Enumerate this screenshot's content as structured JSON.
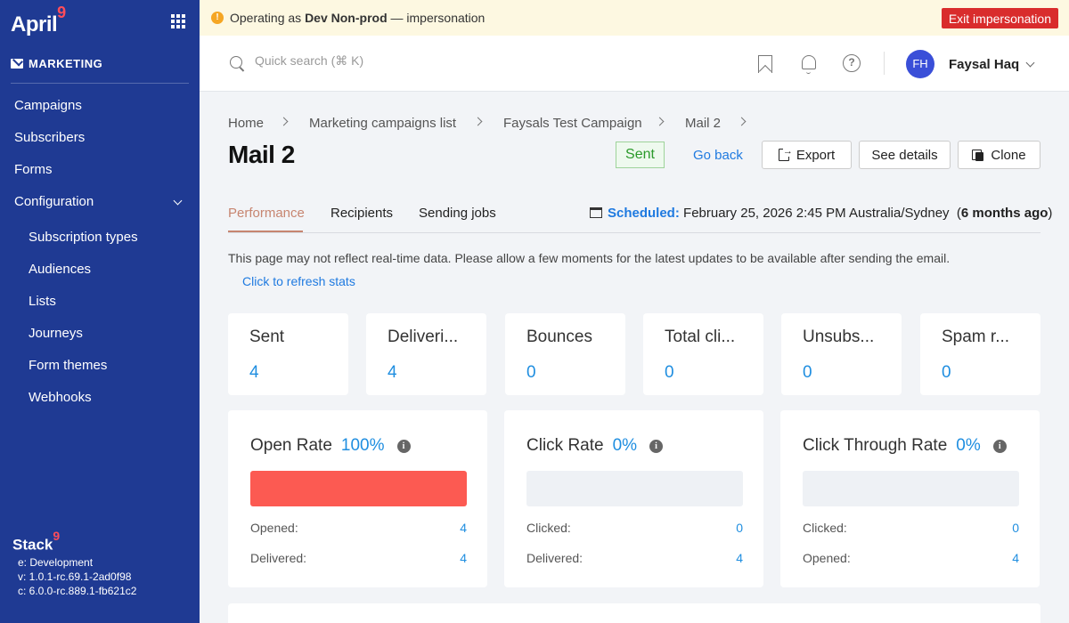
{
  "sidebar": {
    "logo": "April",
    "logo_sup": "9",
    "section": "MARKETING",
    "items": [
      {
        "label": "Campaigns"
      },
      {
        "label": "Subscribers"
      },
      {
        "label": "Forms"
      },
      {
        "label": "Configuration"
      }
    ],
    "sub_items": [
      {
        "label": "Subscription types"
      },
      {
        "label": "Audiences"
      },
      {
        "label": "Lists"
      },
      {
        "label": "Journeys"
      },
      {
        "label": "Form themes"
      },
      {
        "label": "Webhooks"
      }
    ],
    "stack_logo": "Stack",
    "stack_sup": "9",
    "build": {
      "env": "e: Development",
      "version": "v: 1.0.1-rc.69.1-2ad0f98",
      "core": "c: 6.0.0-rc.889.1-fb621c2"
    }
  },
  "banner": {
    "prefix": "Operating as",
    "org": "Dev Non-prod",
    "suffix": "— impersonation",
    "exit_label": "Exit impersonation",
    "warn_glyph": "!"
  },
  "header": {
    "search_placeholder": "Quick search (⌘ K)",
    "help_glyph": "?",
    "user": {
      "initials": "FH",
      "name": "Faysal Haq"
    }
  },
  "breadcrumb": [
    "Home",
    "Marketing campaigns list",
    "Faysals Test Campaign",
    "Mail 2"
  ],
  "page": {
    "title": "Mail 2",
    "status": "Sent",
    "go_back": "Go back",
    "actions": {
      "export": "Export",
      "details": "See details",
      "clone": "Clone"
    }
  },
  "tabs": [
    "Performance",
    "Recipients",
    "Sending jobs"
  ],
  "scheduled": {
    "label": "Scheduled:",
    "value": "February 25, 2026 2:45 PM Australia/Sydney",
    "relative": "6 months ago"
  },
  "notice": "This page may not reflect real-time data. Please allow a few moments for the latest updates to be available after sending the email.",
  "refresh_label": "Click to refresh stats",
  "stats": [
    {
      "title": "Sent",
      "value": "4"
    },
    {
      "title": "Deliveri...",
      "value": "4"
    },
    {
      "title": "Bounces",
      "value": "0"
    },
    {
      "title": "Total cli...",
      "value": "0"
    },
    {
      "title": "Unsubs...",
      "value": "0"
    },
    {
      "title": "Spam r...",
      "value": "0"
    }
  ],
  "rates": [
    {
      "title": "Open Rate",
      "pct": "100%",
      "fill": 100,
      "color": "#fc5a52",
      "rows": [
        {
          "label": "Opened:",
          "value": "4"
        },
        {
          "label": "Delivered:",
          "value": "4"
        }
      ]
    },
    {
      "title": "Click Rate",
      "pct": "0%",
      "fill": 0,
      "color": "#fc5a52",
      "rows": [
        {
          "label": "Clicked:",
          "value": "0"
        },
        {
          "label": "Delivered:",
          "value": "4"
        }
      ]
    },
    {
      "title": "Click Through Rate",
      "pct": "0%",
      "fill": 0,
      "color": "#fc5a52",
      "rows": [
        {
          "label": "Clicked:",
          "value": "0"
        },
        {
          "label": "Opened:",
          "value": "4"
        }
      ]
    }
  ],
  "info_glyph": "i"
}
